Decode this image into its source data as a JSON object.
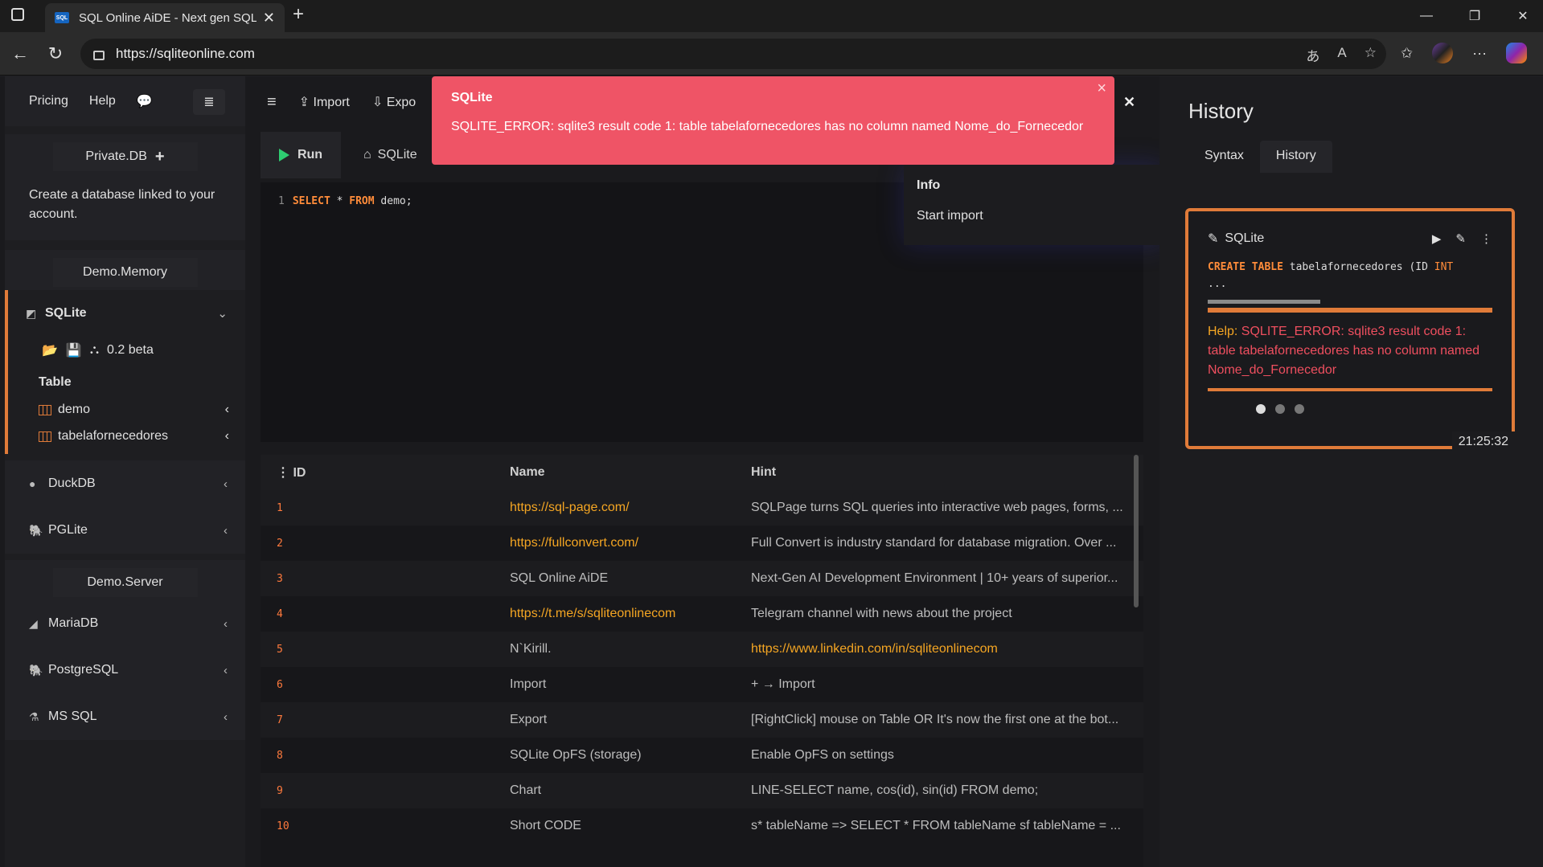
{
  "browser": {
    "tab_title": "SQL Online AiDE - Next gen SQL I",
    "tab_favicon": "SQL",
    "url": "https://sqliteonline.com"
  },
  "sidebar": {
    "nav": [
      "Pricing",
      "Help"
    ],
    "private_db": "Private.DB",
    "private_text": "Create a database linked to your account.",
    "demo_memory": "Demo.Memory",
    "sqlite_label": "SQLite",
    "version": "0.2 beta",
    "table_heading": "Table",
    "tables": [
      "demo",
      "tabelafornecedores"
    ],
    "duckdb": "DuckDB",
    "pglite": "PGLite",
    "demo_server": "Demo.Server",
    "mariadb": "MariaDB",
    "postgresql": "PostgreSQL",
    "mssql": "MS SQL"
  },
  "editor": {
    "import_label": "Import",
    "export_label": "Expo",
    "run_label": "Run",
    "tab_label": "SQLite",
    "line_no": "1",
    "code_kw1": "SELECT",
    "code_mid": " * ",
    "code_kw2": "FROM",
    "code_rest": " demo;"
  },
  "menu": {
    "heading": "Info",
    "item": "Start import"
  },
  "toast": {
    "title": "SQLite",
    "message": "SQLITE_ERROR: sqlite3 result code 1: table tabelafornecedores has no column named Nome_do_Fornecedor"
  },
  "results": {
    "columns": [
      "ID",
      "Name",
      "Hint"
    ],
    "rows": [
      {
        "id": "1",
        "name": "https://sql-page.com/",
        "hint": "SQLPage turns SQL queries into interactive web pages, forms, ..."
      },
      {
        "id": "2",
        "name": "https://fullconvert.com/",
        "hint": "Full Convert is industry standard for database migration. Over ..."
      },
      {
        "id": "3",
        "name": "SQL Online AiDE",
        "hint": "Next-Gen AI Development Environment | 10+ years of superior..."
      },
      {
        "id": "4",
        "name": "https://t.me/s/sqliteonlinecom",
        "hint": "Telegram channel with news about the project"
      },
      {
        "id": "5",
        "name": "N`Kirill.",
        "hint": "https://www.linkedin.com/in/sqliteonlinecom"
      },
      {
        "id": "6",
        "name": "Import",
        "hint": "+ → Import"
      },
      {
        "id": "7",
        "name": "Export",
        "hint": "[RightClick] mouse on Table OR It's now the first one at the bot..."
      },
      {
        "id": "8",
        "name": "SQLite OpFS (storage)",
        "hint": "Enable OpFS on settings"
      },
      {
        "id": "9",
        "name": "Chart",
        "hint": "LINE-SELECT name, cos(id), sin(id) FROM demo;"
      },
      {
        "id": "10",
        "name": "Short CODE",
        "hint": "s* tableName => SELECT * FROM tableName sf tableName = ..."
      }
    ]
  },
  "history": {
    "title": "History",
    "tabs": [
      "Syntax",
      "History"
    ],
    "card_db": "SQLite",
    "code_kw": "CREATE TABLE",
    "code_rest": " tabelafornecedores (ID ",
    "code_type": "INT",
    "code_more": "...",
    "help_label": "Help:",
    "error_text": " SQLITE_ERROR: sqlite3 result code 1: table tabelafornecedores has no column named Nome_do_Fornecedor",
    "time": "21:25:32"
  },
  "colors": {
    "accent": "#e07b39",
    "error": "#ef5466",
    "link": "#f5a623",
    "run": "#2ecc71"
  }
}
